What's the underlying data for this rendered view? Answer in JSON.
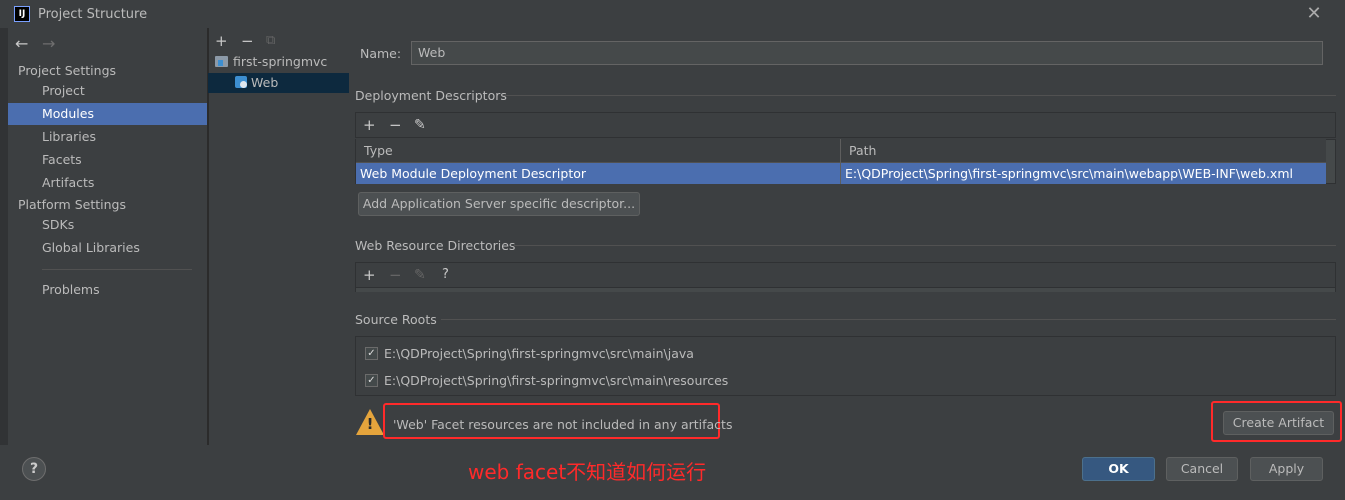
{
  "window": {
    "title": "Project Structure",
    "logo_text": "IJ",
    "close_glyph": "✕"
  },
  "nav": {
    "back_glyph": "←",
    "forward_glyph": "→",
    "project_settings_header": "Project Settings",
    "project_items": [
      "Project",
      "Modules",
      "Libraries",
      "Facets",
      "Artifacts"
    ],
    "selected_item": "Modules",
    "platform_settings_header": "Platform Settings",
    "platform_items": [
      "SDKs",
      "Global Libraries"
    ],
    "problems_label": "Problems"
  },
  "tree": {
    "toolbar": {
      "add": "+",
      "remove": "−",
      "copy": "⧉"
    },
    "module_name": "first-springmvc",
    "facet_name": "Web"
  },
  "facet": {
    "name_label": "Name:",
    "name_value": "Web",
    "deployment": {
      "title": "Deployment Descriptors",
      "toolbar": {
        "add": "+",
        "remove": "−",
        "edit": "✎"
      },
      "columns": [
        "Type",
        "Path"
      ],
      "rows": [
        {
          "type": "Web Module Deployment Descriptor",
          "path": "E:\\QDProject\\Spring\\first-springmvc\\src\\main\\webapp\\WEB-INF\\web.xml"
        }
      ],
      "add_server_button": "Add Application Server specific descriptor..."
    },
    "resources": {
      "title": "Web Resource Directories",
      "toolbar": {
        "add": "+",
        "remove": "−",
        "edit": "✎",
        "help": "?"
      }
    },
    "source_roots": {
      "title": "Source Roots",
      "items": [
        {
          "path": "E:\\QDProject\\Spring\\first-springmvc\\src\\main\\java",
          "checked": true
        },
        {
          "path": "E:\\QDProject\\Spring\\first-springmvc\\src\\main\\resources",
          "checked": true
        }
      ]
    },
    "warning": {
      "text": "'Web' Facet resources are not included in any artifacts",
      "icon_glyph": "!"
    },
    "create_artifact_button": "Create Artifact"
  },
  "footer": {
    "help_glyph": "?",
    "annotation": "web facet不知道如何运行",
    "ok_button": "OK",
    "cancel_button": "Cancel",
    "apply_button": "Apply"
  },
  "colors": {
    "selection": "#4b6eaf",
    "annotation_red": "#ff2a2a",
    "warning": "#e5a43c",
    "primary_button": "#365880"
  }
}
